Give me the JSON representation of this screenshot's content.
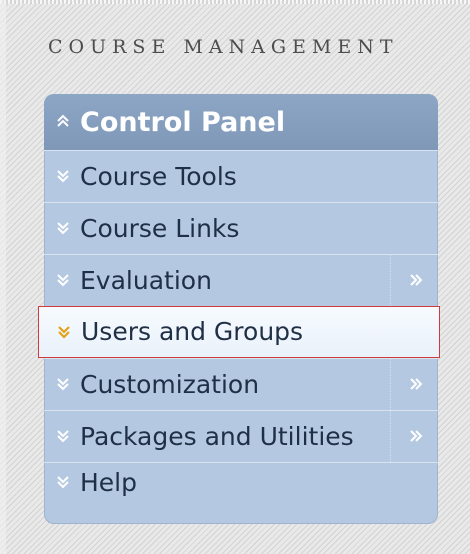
{
  "section": {
    "title": "COURSE MANAGEMENT"
  },
  "panel": {
    "header_label": "Control Panel",
    "items": [
      {
        "label": "Course Tools",
        "has_flyout": false,
        "active": false
      },
      {
        "label": "Course Links",
        "has_flyout": false,
        "active": false
      },
      {
        "label": "Evaluation",
        "has_flyout": true,
        "active": false
      },
      {
        "label": "Users and Groups",
        "has_flyout": false,
        "active": true
      },
      {
        "label": "Customization",
        "has_flyout": true,
        "active": false
      },
      {
        "label": "Packages and Utilities",
        "has_flyout": true,
        "active": false
      },
      {
        "label": "Help",
        "has_flyout": false,
        "active": false
      }
    ]
  },
  "icons": {
    "expand": "chevron-double-down-icon",
    "collapse": "chevron-double-up-icon",
    "flyout": "chevron-double-right-icon"
  },
  "colors": {
    "panel_background": "#b4c8e1",
    "header_background": "#8aa3c2",
    "item_text": "#1f2f45",
    "active_highlight_border": "#cf3a3a",
    "active_chevron": "#e3a21a",
    "chevron": "#ffffff"
  }
}
